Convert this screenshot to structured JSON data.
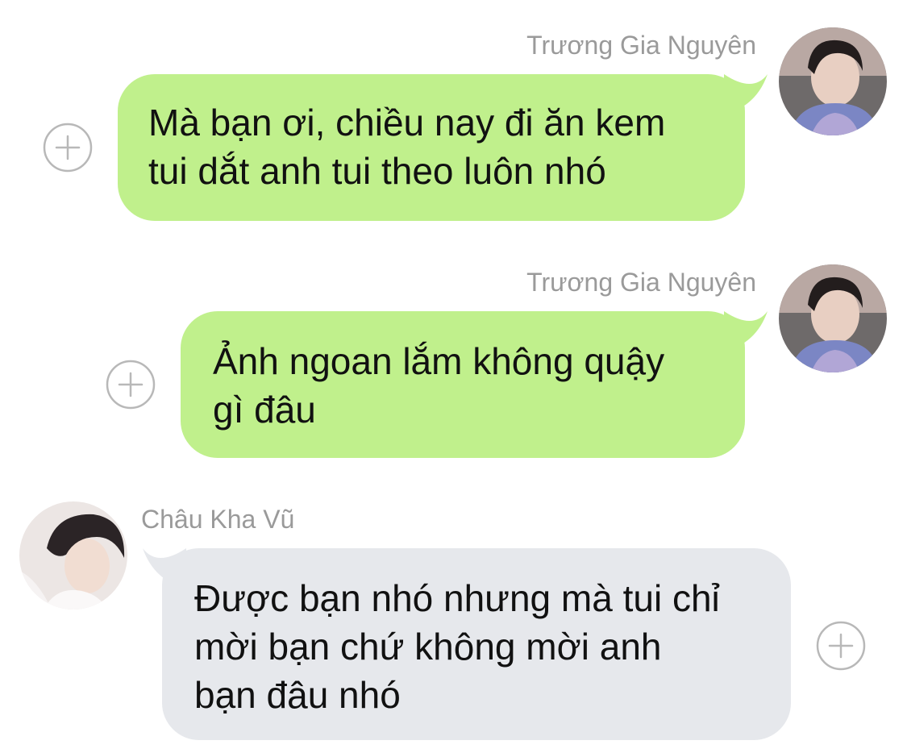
{
  "messages": [
    {
      "sender": "Trương Gia Nguyên",
      "text": "Mà bạn ơi, chiều nay đi ăn kem\ntui dắt anh tui theo luôn nhó",
      "direction": "outgoing"
    },
    {
      "sender": "Trương Gia Nguyên",
      "text": "Ảnh ngoan lắm không quậy\ngì đâu",
      "direction": "outgoing"
    },
    {
      "sender": "Châu Kha Vũ",
      "text": "Được bạn nhó nhưng mà tui chỉ\nmời bạn chứ không mời anh\nbạn đâu nhó",
      "direction": "incoming"
    }
  ],
  "icons": {
    "add": "plus-circle-icon",
    "avatar": "user-avatar"
  },
  "colors": {
    "outgoing_bubble": "#c0f08c",
    "incoming_bubble": "#e6e8ec",
    "sender_name": "#9a9a9a",
    "plus_icon": "#b8b8b8"
  }
}
